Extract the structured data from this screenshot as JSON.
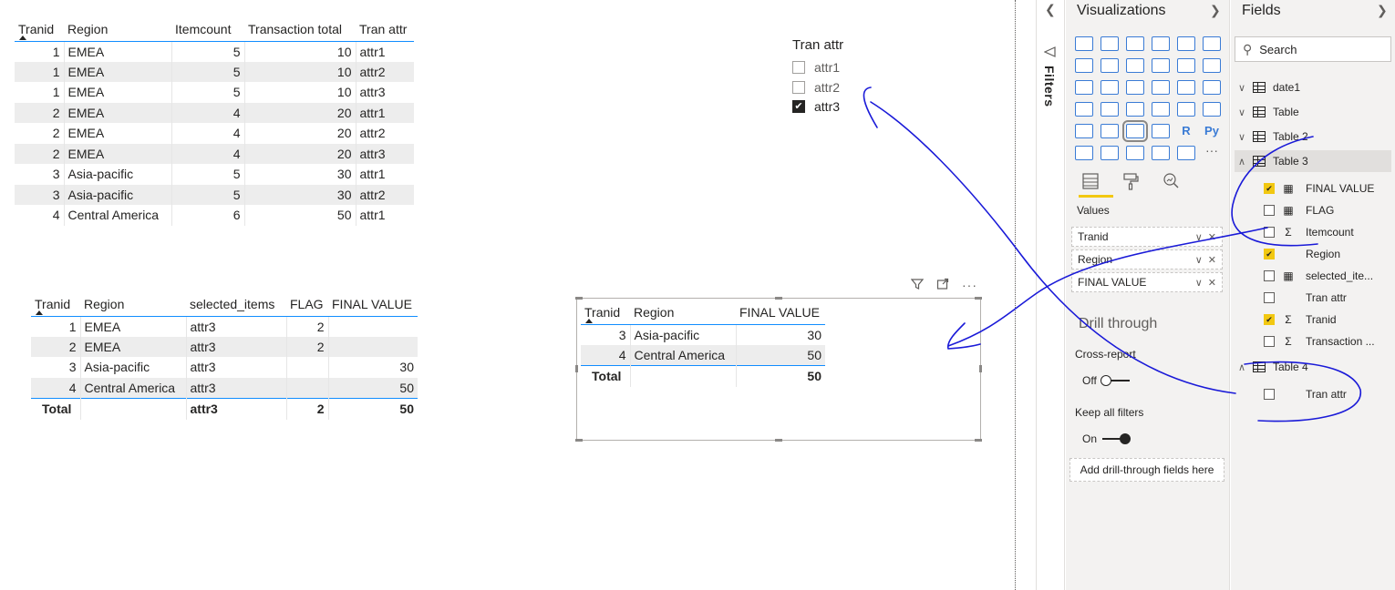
{
  "table1": {
    "headers": [
      "Tranid",
      "Region",
      "Itemcount",
      "Transaction total",
      "Tran attr"
    ],
    "rows": [
      [
        "1",
        "EMEA",
        "5",
        "10",
        "attr1"
      ],
      [
        "1",
        "EMEA",
        "5",
        "10",
        "attr2"
      ],
      [
        "1",
        "EMEA",
        "5",
        "10",
        "attr3"
      ],
      [
        "2",
        "EMEA",
        "4",
        "20",
        "attr1"
      ],
      [
        "2",
        "EMEA",
        "4",
        "20",
        "attr2"
      ],
      [
        "2",
        "EMEA",
        "4",
        "20",
        "attr3"
      ],
      [
        "3",
        "Asia-pacific",
        "5",
        "30",
        "attr1"
      ],
      [
        "3",
        "Asia-pacific",
        "5",
        "30",
        "attr2"
      ],
      [
        "4",
        "Central America",
        "6",
        "50",
        "attr1"
      ]
    ]
  },
  "table2": {
    "headers": [
      "Tranid",
      "Region",
      "selected_items",
      "FLAG",
      "FINAL VALUE"
    ],
    "rows": [
      [
        "1",
        "EMEA",
        "attr3",
        "2",
        ""
      ],
      [
        "2",
        "EMEA",
        "attr3",
        "2",
        ""
      ],
      [
        "3",
        "Asia-pacific",
        "attr3",
        "",
        "30"
      ],
      [
        "4",
        "Central America",
        "attr3",
        "",
        "50"
      ]
    ],
    "total": [
      "Total",
      "",
      "attr3",
      "2",
      "50"
    ]
  },
  "table3": {
    "headers": [
      "Tranid",
      "Region",
      "FINAL VALUE"
    ],
    "rows": [
      [
        "3",
        "Asia-pacific",
        "30"
      ],
      [
        "4",
        "Central America",
        "50"
      ]
    ],
    "total": [
      "Total",
      "",
      "50"
    ]
  },
  "slicer": {
    "title": "Tran attr",
    "items": [
      {
        "label": "attr1",
        "checked": false
      },
      {
        "label": "attr2",
        "checked": false
      },
      {
        "label": "attr3",
        "checked": true
      }
    ]
  },
  "filters_pane": {
    "label": "Filters"
  },
  "viz_pane": {
    "title": "Visualizations",
    "values_label": "Values",
    "wells": [
      "Tranid",
      "Region",
      "FINAL VALUE"
    ],
    "drill_title": "Drill through",
    "cross_report_label": "Cross-report",
    "cross_report_state": "Off",
    "keep_filters_label": "Keep all filters",
    "keep_filters_state": "On",
    "drill_well": "Add drill-through fields here"
  },
  "fields_pane": {
    "title": "Fields",
    "search_placeholder": "Search",
    "tables": [
      "date1",
      "Table",
      "Table 2",
      "Table 3",
      "Table 4"
    ],
    "table3_fields": [
      {
        "label": "FINAL VALUE",
        "checked": true,
        "type": "calc"
      },
      {
        "label": "FLAG",
        "checked": false,
        "type": "calc"
      },
      {
        "label": "Itemcount",
        "checked": false,
        "type": "sigma"
      },
      {
        "label": "Region",
        "checked": true,
        "type": "none"
      },
      {
        "label": "selected_ite...",
        "checked": false,
        "type": "calc"
      },
      {
        "label": "Tran attr",
        "checked": false,
        "type": "none"
      },
      {
        "label": "Tranid",
        "checked": true,
        "type": "sigma"
      },
      {
        "label": "Transaction ...",
        "checked": false,
        "type": "sigma"
      }
    ],
    "table4_fields": [
      {
        "label": "Tran attr",
        "checked": false,
        "type": "none"
      }
    ]
  },
  "colors": {
    "accent": "#118dff",
    "yellow": "#f2c811",
    "ink": "#1a1ad8"
  }
}
